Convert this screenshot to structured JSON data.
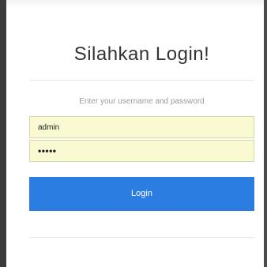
{
  "login": {
    "title": "Silahkan Login!",
    "subtitle": "Enter your username and password",
    "username_value": "admin",
    "password_value": "•••••",
    "button_label": "Login"
  },
  "colors": {
    "button_bg": "#2b7de1",
    "field_bg": "#fafad2"
  }
}
